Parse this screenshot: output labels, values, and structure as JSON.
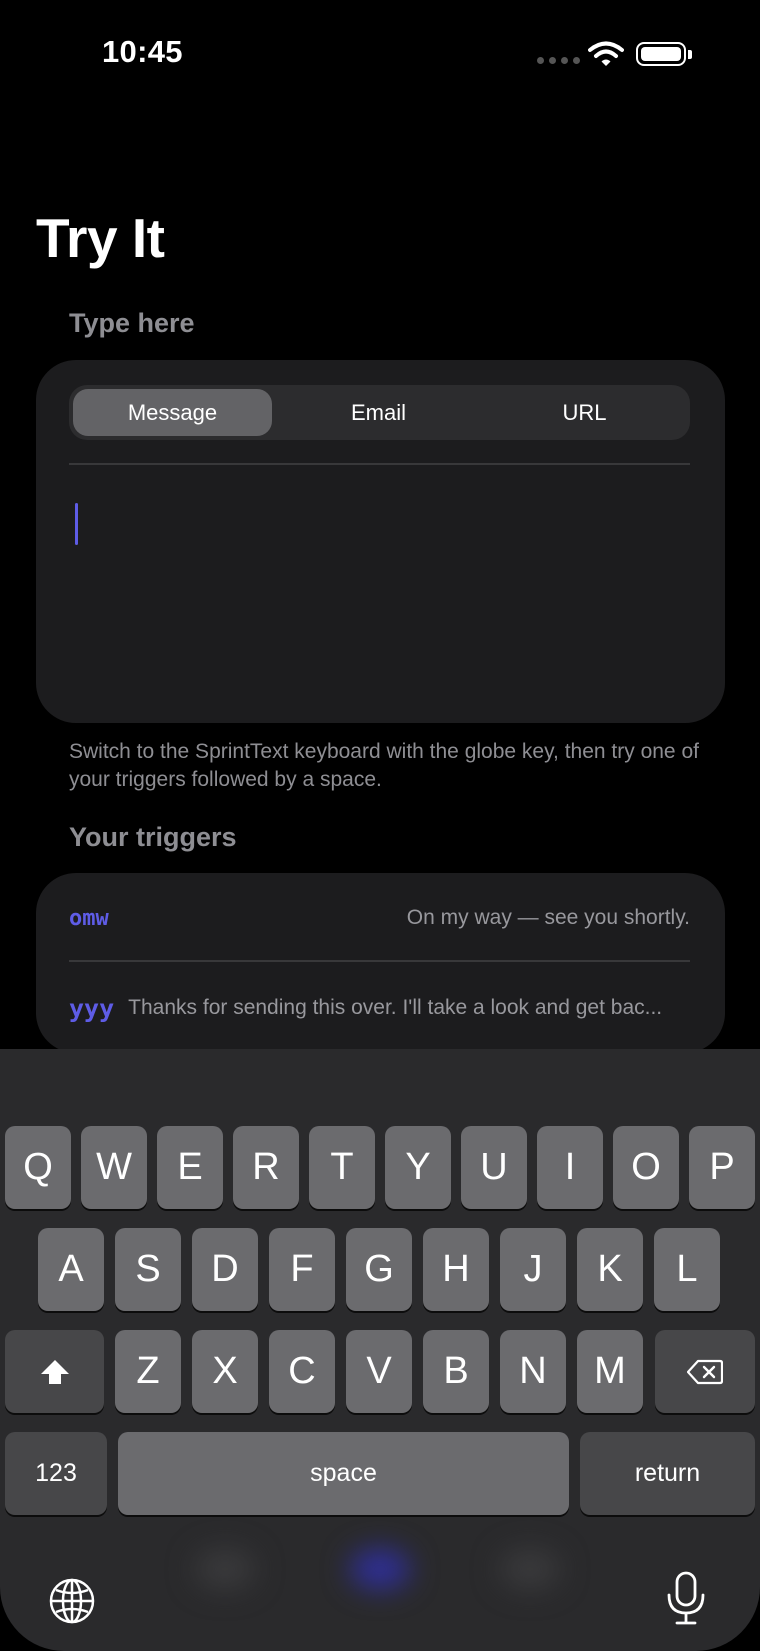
{
  "status_bar": {
    "time": "10:45"
  },
  "page": {
    "title": "Try It"
  },
  "type_here": {
    "header": "Type here",
    "segments": [
      "Message",
      "Email",
      "URL"
    ],
    "selected_segment": "Message",
    "text_value": "",
    "footnote": "Switch to the SprintText keyboard with the globe key, then try one of your triggers followed by a space."
  },
  "triggers": {
    "header": "Your triggers",
    "items": [
      {
        "trigger": "omw",
        "expansion": "On my way — see you shortly."
      },
      {
        "trigger": "yyy",
        "expansion": "Thanks for sending this over. I'll take a look and get bac..."
      }
    ]
  },
  "keyboard": {
    "row1": [
      "Q",
      "W",
      "E",
      "R",
      "T",
      "Y",
      "U",
      "I",
      "O",
      "P"
    ],
    "row2": [
      "A",
      "S",
      "D",
      "F",
      "G",
      "H",
      "J",
      "K",
      "L"
    ],
    "row3": [
      "Z",
      "X",
      "C",
      "V",
      "B",
      "N",
      "M"
    ],
    "numbers_label": "123",
    "space_label": "space",
    "return_label": "return",
    "accent_color": "#5e5ce6"
  },
  "colors": {
    "background": "#000000",
    "card": "#1c1c1e",
    "accent": "#5e5ce6",
    "secondary_text": "#8e8e93"
  }
}
